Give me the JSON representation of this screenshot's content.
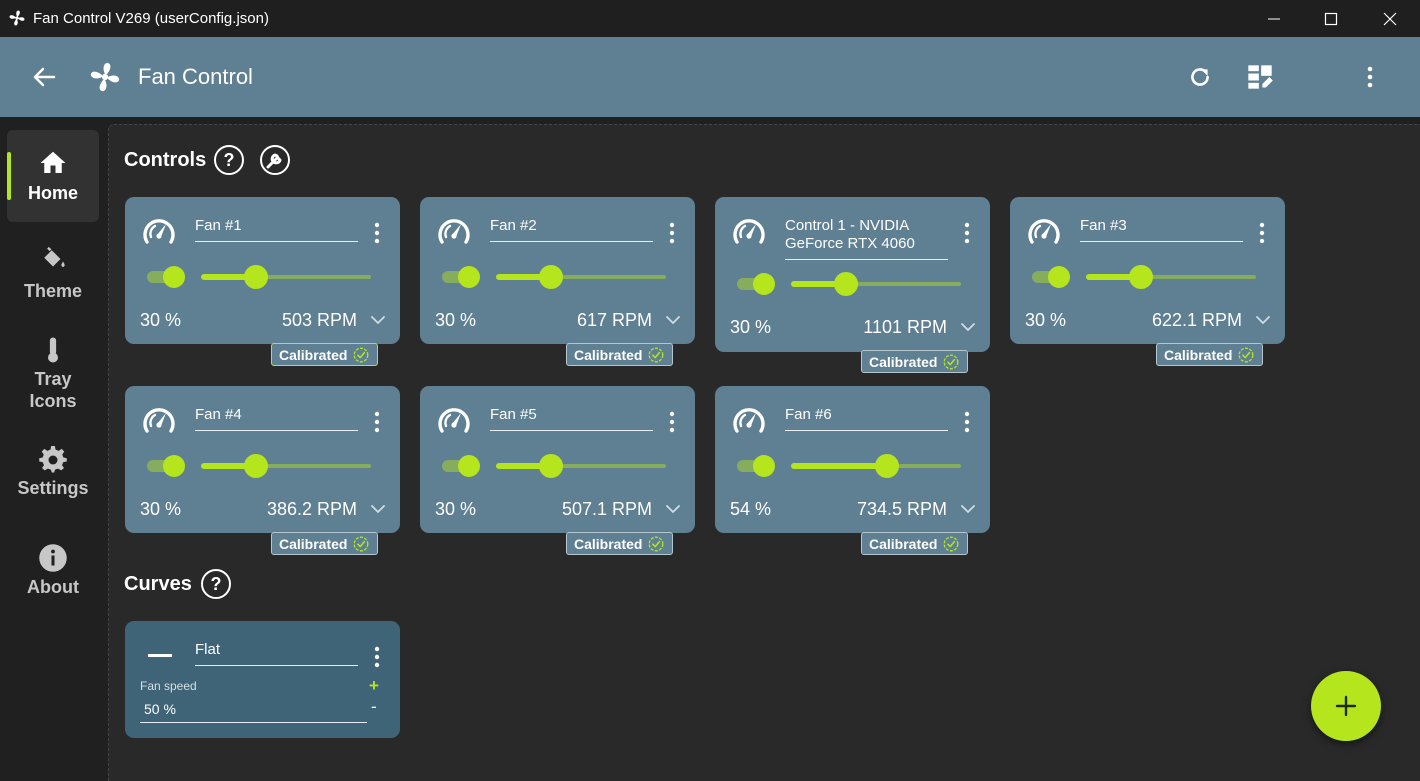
{
  "window": {
    "title": "Fan Control V269 (userConfig.json)"
  },
  "header": {
    "title": "Fan Control"
  },
  "nav": [
    {
      "label": "Home",
      "icon": "home-icon",
      "active": true
    },
    {
      "label": "Theme",
      "icon": "paint-bucket-icon"
    },
    {
      "label": "Tray\nIcons",
      "icon": "thermometer-icon"
    },
    {
      "label": "Settings",
      "icon": "gear-icon"
    },
    {
      "label": "About",
      "icon": "info-icon"
    }
  ],
  "sections": {
    "controls": "Controls",
    "curves": "Curves"
  },
  "controls": [
    {
      "name": "Fan #1",
      "percent_label": "30 %",
      "rpm": "503 RPM",
      "level": 0.3,
      "badge": "Calibrated",
      "badge_highlight": true
    },
    {
      "name": "Fan #2",
      "percent_label": "30 %",
      "rpm": "617 RPM",
      "level": 0.3,
      "badge": "Calibrated"
    },
    {
      "name": "Control 1 - NVIDIA GeForce RTX 4060",
      "percent_label": "30 %",
      "rpm": "1101 RPM",
      "level": 0.3,
      "badge": "Calibrated"
    },
    {
      "name": "Fan #3",
      "percent_label": "30 %",
      "rpm": "622.1 RPM",
      "level": 0.3,
      "badge": "Calibrated"
    },
    {
      "name": "Fan #4",
      "percent_label": "30 %",
      "rpm": "386.2 RPM",
      "level": 0.3,
      "badge": "Calibrated"
    },
    {
      "name": "Fan #5",
      "percent_label": "30 %",
      "rpm": "507.1 RPM",
      "level": 0.3,
      "badge": "Calibrated"
    },
    {
      "name": "Fan #6",
      "percent_label": "54 %",
      "rpm": "734.5 RPM",
      "level": 0.54,
      "badge": "Calibrated"
    }
  ],
  "curves": [
    {
      "name": "Flat",
      "field_label": "Fan speed",
      "value": "50 %",
      "plus": "+",
      "minus": "-"
    }
  ],
  "colors": {
    "accent": "#b5e61d",
    "card": "#5f7f92",
    "curve_card": "#3f6478",
    "background": "#292929"
  }
}
